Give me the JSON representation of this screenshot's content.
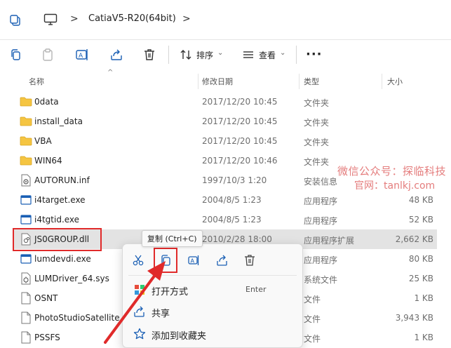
{
  "address": {
    "path_segment": "CatiaV5-R20(64bit)",
    "chevron1": ">",
    "chevron2": ">"
  },
  "toolbar": {
    "sort_label": "排序",
    "view_label": "查看",
    "caret": "⌄",
    "more": "···"
  },
  "columns": {
    "name": "名称",
    "date": "修改日期",
    "type": "类型",
    "size": "大小"
  },
  "files": [
    {
      "name": "0data",
      "date": "2017/12/20 10:45",
      "type": "文件夹",
      "size": "",
      "icon": "folder-icon"
    },
    {
      "name": "install_data",
      "date": "2017/12/20 10:45",
      "type": "文件夹",
      "size": "",
      "icon": "folder-icon"
    },
    {
      "name": "VBA",
      "date": "2017/12/20 10:45",
      "type": "文件夹",
      "size": "",
      "icon": "folder-icon"
    },
    {
      "name": "WIN64",
      "date": "2017/12/20 10:46",
      "type": "文件夹",
      "size": "",
      "icon": "folder-icon"
    },
    {
      "name": "AUTORUN.inf",
      "date": "1997/10/3 1:20",
      "type": "安装信息",
      "size": "",
      "icon": "settings-file-icon"
    },
    {
      "name": "i4target.exe",
      "date": "2004/8/5 1:23",
      "type": "应用程序",
      "size": "48 KB",
      "icon": "exe-icon"
    },
    {
      "name": "i4tgtid.exe",
      "date": "2004/8/5 1:23",
      "type": "应用程序",
      "size": "52 KB",
      "icon": "exe-icon"
    },
    {
      "name": "JS0GROUP.dll",
      "date": "2010/2/28 18:00",
      "type": "应用程序扩展",
      "size": "2,662 KB",
      "icon": "dll-icon"
    },
    {
      "name": "lumdevdi.exe",
      "date": "",
      "type": "应用程序",
      "size": "80 KB",
      "icon": "exe-icon"
    },
    {
      "name": "LUMDriver_64.sys",
      "date": "",
      "type": "系统文件",
      "size": "25 KB",
      "icon": "sys-file-icon"
    },
    {
      "name": "OSNT",
      "date": "",
      "type": "文件",
      "size": "1 KB",
      "icon": "blank-file-icon"
    },
    {
      "name": "PhotoStudioSatellite",
      "date": "",
      "type": "文件",
      "size": "3,943 KB",
      "icon": "blank-file-icon"
    },
    {
      "name": "PSSFS",
      "date": "",
      "type": "文件",
      "size": "1 KB",
      "icon": "blank-file-icon"
    }
  ],
  "tooltip": {
    "text": "复制 (Ctrl+C)"
  },
  "context_menu": {
    "open_with": "打开方式",
    "open_with_shortcut": "Enter",
    "share": "共享",
    "add_favorite": "添加到收藏夹"
  },
  "watermark": {
    "line1": "微信公众号：探临科技",
    "line2": "官网：tanlkj.com"
  },
  "colors": {
    "highlight_red": "#e02a2a",
    "selected_row": "#e3e3e3",
    "folder_yellow": "#f5c542",
    "accent_blue": "#1a5fb4"
  }
}
